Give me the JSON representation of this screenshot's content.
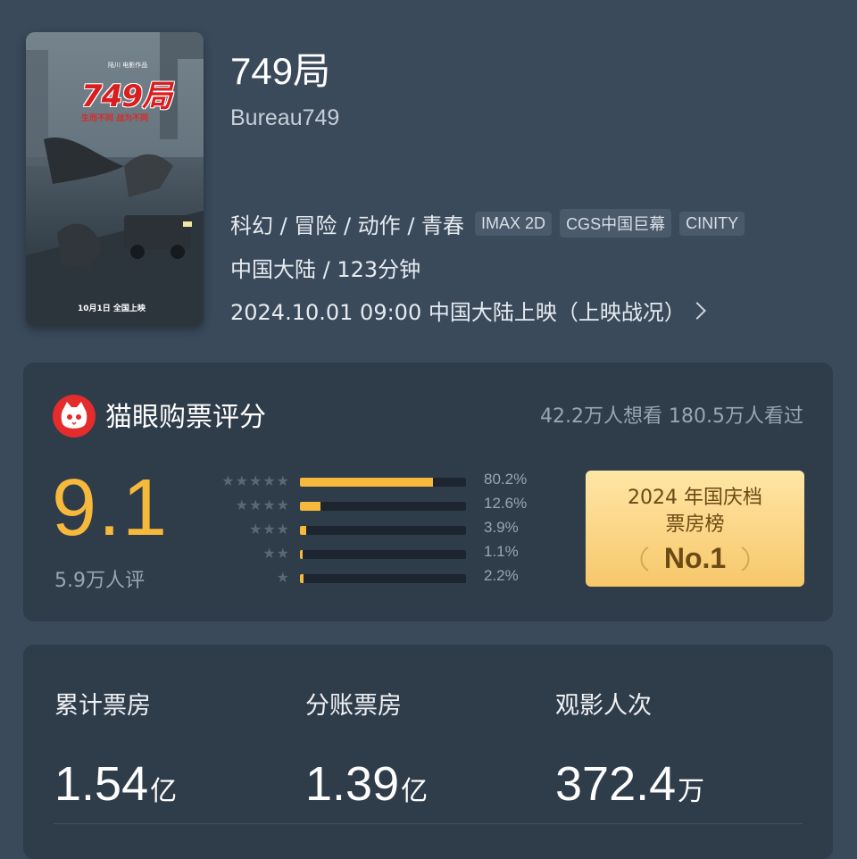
{
  "movie": {
    "poster": {
      "title": "749局",
      "top_text": "陆川 电影作品",
      "tagline": "生而不同 战为不同",
      "release_note": "10月1日 全国上映"
    },
    "title": "749局",
    "english_title": "Bureau749",
    "genres": "科幻 / 冒险 / 动作 / 青春",
    "formats": [
      "IMAX 2D",
      "CGS中国巨幕",
      "CINITY"
    ],
    "origin_duration": "中国大陆 / 123分钟",
    "release": "2024.10.01 09:00 中国大陆上映（上映战况）"
  },
  "rating": {
    "title": "猫眼购票评分",
    "want_watched": "42.2万人想看 180.5万人看过",
    "score": "9.1",
    "count": "5.9万人评",
    "distribution": [
      {
        "stars": "★★★★★",
        "percent": 80.2,
        "label": "80.2%"
      },
      {
        "stars": "★★★★",
        "percent": 12.6,
        "label": "12.6%"
      },
      {
        "stars": "★★★",
        "percent": 3.9,
        "label": "3.9%"
      },
      {
        "stars": "★★",
        "percent": 1.1,
        "label": "1.1%"
      },
      {
        "stars": "★",
        "percent": 2.2,
        "label": "2.2%"
      }
    ],
    "rank": {
      "line1": "2024 年国庆档",
      "line2": "票房榜",
      "position": "No.1"
    }
  },
  "box_office": {
    "items": [
      {
        "label": "累计票房",
        "value": "1.54",
        "unit": "亿"
      },
      {
        "label": "分账票房",
        "value": "1.39",
        "unit": "亿"
      },
      {
        "label": "观影人次",
        "value": "372.4",
        "unit": "万"
      }
    ]
  },
  "colors": {
    "background": "#3a4a5b",
    "card": "#2f3c4a",
    "accent": "#f6b93b",
    "maoyan_red": "#e42c2c"
  }
}
